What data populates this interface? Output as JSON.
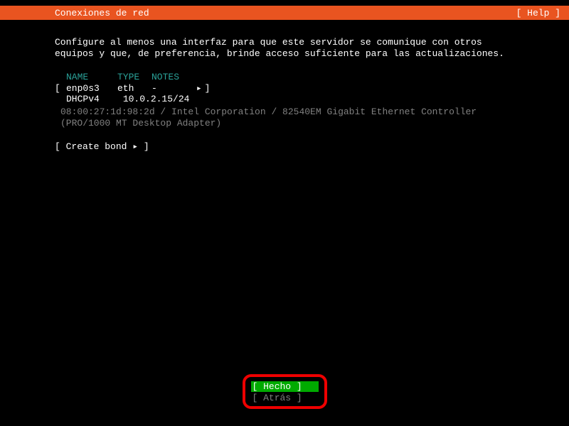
{
  "header": {
    "title": "Conexiones de red",
    "help": "[ Help ]"
  },
  "description": "Configure al menos una interfaz para que este servidor se comunique con otros equipos y que, de preferencia, brinde acceso suficiente para las actualizaciones.",
  "table": {
    "headers": {
      "name": "NAME",
      "type": "TYPE",
      "notes": "NOTES"
    },
    "interface": {
      "bracket_open": "[",
      "name": "enp0s3",
      "type": "eth",
      "notes": "-",
      "arrow": "▸",
      "bracket_close": "]",
      "dhcp_label": "DHCPv4",
      "dhcp_value": "10.0.2.15/24"
    },
    "hw_line1": "08:00:27:1d:98:2d / Intel Corporation / 82540EM Gigabit Ethernet Controller",
    "hw_line2": "(PRO/1000 MT Desktop Adapter)"
  },
  "create_bond": {
    "text": "[ Create bond ▸ ]"
  },
  "footer": {
    "done": "[ Hecho       ]",
    "back": "[ Atrás       ]"
  }
}
